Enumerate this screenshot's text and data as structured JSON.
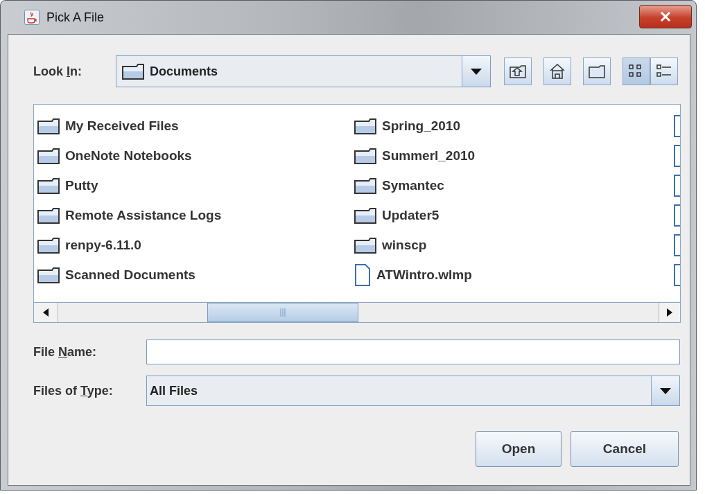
{
  "window": {
    "title": "Pick A File"
  },
  "look_in": {
    "label_parts": [
      "Look ",
      "I",
      "n:"
    ],
    "value": "Documents"
  },
  "toolbar": [
    {
      "kind": "up"
    },
    {
      "kind": "home"
    },
    {
      "kind": "new-folder"
    },
    {
      "kind": "list",
      "selected": true
    },
    {
      "kind": "details",
      "selected": false
    }
  ],
  "files": [
    [
      {
        "kind": "folder",
        "name": "My Received Files"
      },
      {
        "kind": "folder",
        "name": "OneNote Notebooks"
      },
      {
        "kind": "folder",
        "name": "Putty"
      },
      {
        "kind": "folder",
        "name": "Remote Assistance Logs"
      },
      {
        "kind": "folder",
        "name": "renpy-6.11.0"
      },
      {
        "kind": "folder",
        "name": "Scanned Documents"
      }
    ],
    [
      {
        "kind": "folder",
        "name": "Spring_2010"
      },
      {
        "kind": "folder",
        "name": "Summerl_2010"
      },
      {
        "kind": "folder",
        "name": "Symantec"
      },
      {
        "kind": "folder",
        "name": "Updater5"
      },
      {
        "kind": "folder",
        "name": "winscp"
      },
      {
        "kind": "file",
        "name": "ATWintro.wlmp"
      }
    ],
    [
      {
        "kind": "file"
      },
      {
        "kind": "file"
      },
      {
        "kind": "file"
      },
      {
        "kind": "file"
      },
      {
        "kind": "file"
      },
      {
        "kind": "file"
      }
    ]
  ],
  "file_name": {
    "label_parts": [
      "File ",
      "N",
      "ame:"
    ]
  },
  "files_of_type": {
    "label_parts": [
      "Files of ",
      "T",
      "ype:"
    ],
    "value": "All Files"
  },
  "buttons": [
    "Open",
    "Cancel"
  ]
}
